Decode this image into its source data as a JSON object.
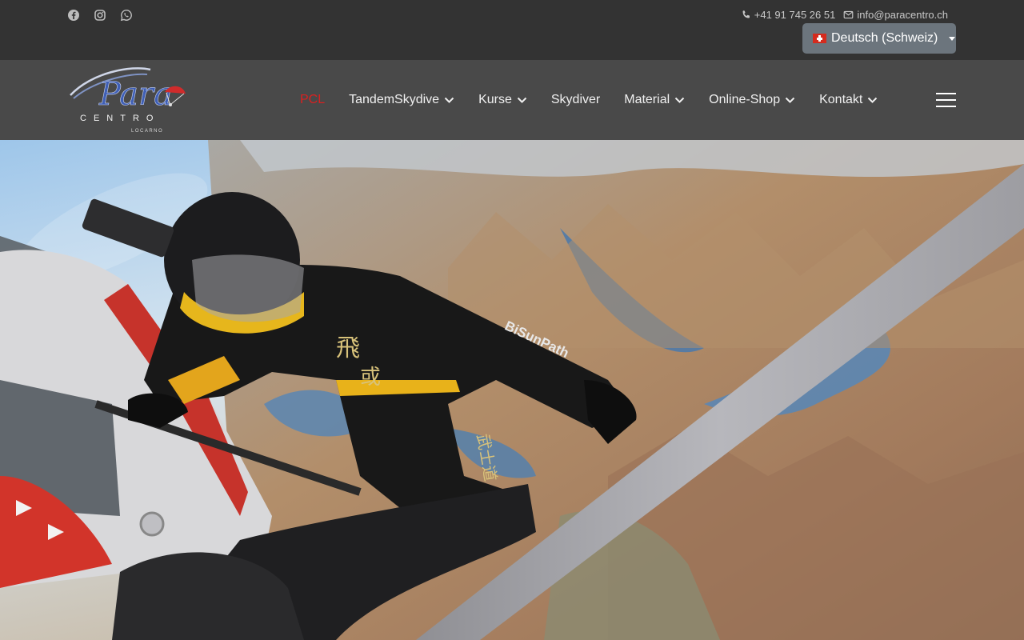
{
  "topbar": {
    "social": [
      {
        "icon": "facebook-icon"
      },
      {
        "icon": "instagram-icon"
      },
      {
        "icon": "whatsapp-icon"
      }
    ],
    "phone": "+41 91 745 26 51",
    "email": "info@paracentro.ch",
    "language": {
      "selected": "Deutsch (Schweiz)",
      "flag": "swiss-flag-icon"
    }
  },
  "nav": {
    "logo": {
      "wordmark": "Para",
      "name": "CENTRO",
      "place": "LOCARNO"
    },
    "items": [
      {
        "label": "PCL",
        "dropdown": false,
        "active": true
      },
      {
        "label": "TandemSkydive",
        "dropdown": true,
        "active": false
      },
      {
        "label": "Kurse",
        "dropdown": true,
        "active": false
      },
      {
        "label": "Skydiver",
        "dropdown": false,
        "active": false
      },
      {
        "label": "Material",
        "dropdown": true,
        "active": false
      },
      {
        "label": "Online-Shop",
        "dropdown": true,
        "active": false
      },
      {
        "label": "Kontakt",
        "dropdown": true,
        "active": false
      }
    ],
    "menu_icon": "hamburger-icon"
  },
  "hero": {
    "jumpsuit_text": [
      "飛",
      "或",
      "武士道"
    ],
    "sleeve_text": "BiSunPath",
    "colors": {
      "accent": "#d92020",
      "topbar": "#333333",
      "navbar": "#494949",
      "language_button": "#6c757d"
    }
  }
}
